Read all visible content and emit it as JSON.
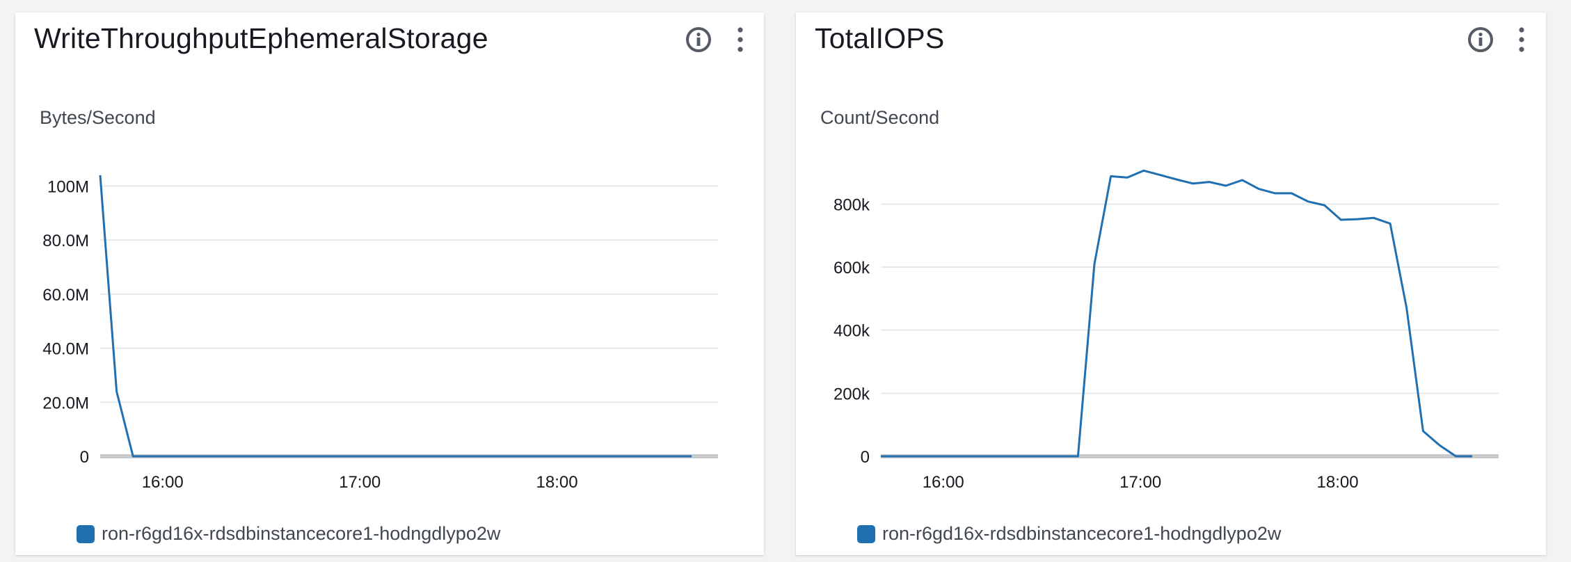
{
  "colors": {
    "series": "#1f6fb1",
    "grid": "#e8e9ea",
    "baseline": "#c8cacc",
    "icon": "#545b64"
  },
  "icons": {
    "info": "info-icon",
    "more": "more-vertical-icon"
  },
  "chart_data": [
    {
      "type": "line",
      "title": "WriteThroughputEphemeralStorage",
      "ylabel": "Bytes/Second",
      "xlabel": "",
      "ylim": [
        0,
        105000000
      ],
      "yticks": [
        0,
        20000000,
        40000000,
        60000000,
        80000000,
        100000000
      ],
      "ytick_labels": [
        "0",
        "20.0M",
        "40.0M",
        "60.0M",
        "80.0M",
        "100M"
      ],
      "xlim": [
        "15:41",
        "18:49"
      ],
      "xticks": [
        "16:00",
        "17:00",
        "18:00"
      ],
      "grid": true,
      "legend_position": "bottom",
      "series": [
        {
          "name": "ron-r6gd16x-rdsdbinstancecore1-hodngdlypo2w",
          "x": [
            "15:41",
            "15:46",
            "15:51",
            "18:41"
          ],
          "y": [
            104000000,
            24000000,
            0,
            0
          ]
        }
      ]
    },
    {
      "type": "line",
      "title": "TotalIOPS",
      "ylabel": "Count/Second",
      "xlabel": "",
      "ylim": [
        0,
        900000
      ],
      "yticks": [
        0,
        200000,
        400000,
        600000,
        800000
      ],
      "ytick_labels": [
        "0",
        "200k",
        "400k",
        "600k",
        "800k"
      ],
      "xlim": [
        "15:41",
        "18:49"
      ],
      "xticks": [
        "16:00",
        "17:00",
        "18:00"
      ],
      "grid": true,
      "legend_position": "bottom",
      "series": [
        {
          "name": "ron-r6gd16x-rdsdbinstancecore1-hodngdlypo2w",
          "x": [
            "15:41",
            "16:41",
            "16:46",
            "16:51",
            "16:56",
            "17:01",
            "17:06",
            "17:11",
            "17:16",
            "17:21",
            "17:26",
            "17:31",
            "17:36",
            "17:41",
            "17:46",
            "17:51",
            "17:56",
            "18:01",
            "18:06",
            "18:11",
            "18:16",
            "18:21",
            "18:26",
            "18:31",
            "18:36",
            "18:41"
          ],
          "y": [
            0,
            0,
            610000,
            888000,
            884000,
            906000,
            892000,
            878000,
            865000,
            870000,
            858000,
            876000,
            848000,
            834000,
            834000,
            808000,
            796000,
            750000,
            752000,
            756000,
            738000,
            470000,
            80000,
            35000,
            0,
            0
          ]
        }
      ]
    }
  ]
}
